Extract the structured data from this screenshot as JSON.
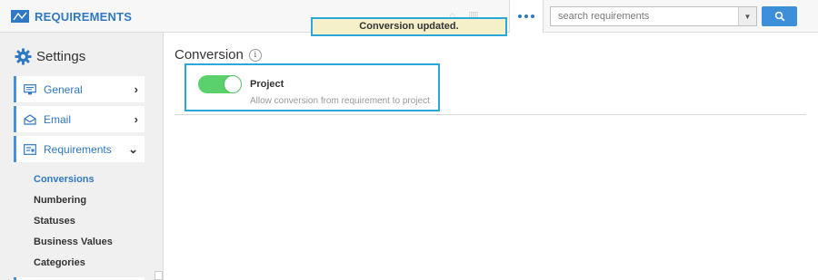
{
  "app": {
    "title": "REQUIREMENTS",
    "brand_color": "#2f78c4"
  },
  "toast": {
    "text": "Conversion updated."
  },
  "toolbar": {
    "more_icon": "ellipsis-icon",
    "search_placeholder": "search requirements",
    "search_value": "",
    "search_button_icon": "magnifier-icon"
  },
  "sidebar": {
    "heading": "Settings",
    "nav": [
      {
        "label": "General",
        "icon": "monitor-icon",
        "chevron": "›",
        "expanded": false
      },
      {
        "label": "Email",
        "icon": "envelope-icon",
        "chevron": "›",
        "expanded": false
      },
      {
        "label": "Requirements",
        "icon": "list-icon",
        "chevron": "⌄",
        "expanded": true
      }
    ],
    "sub_items": [
      {
        "label": "Conversions",
        "active": true
      },
      {
        "label": "Numbering",
        "active": false
      },
      {
        "label": "Statuses",
        "active": false
      },
      {
        "label": "Business Values",
        "active": false
      },
      {
        "label": "Categories",
        "active": false
      }
    ]
  },
  "main": {
    "section_title": "Conversion",
    "info_glyph": "i",
    "conversion": {
      "title": "Project",
      "description": "Allow conversion from requirement to project",
      "enabled": true,
      "toggle_color": "#5bd16d"
    }
  }
}
